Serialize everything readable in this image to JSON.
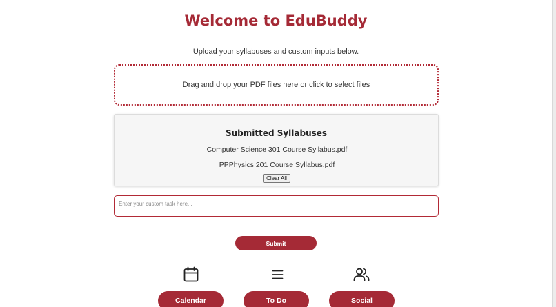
{
  "header": {
    "title": "Welcome to EduBuddy",
    "subtitle": "Upload your syllabuses and custom inputs below."
  },
  "dropzone": {
    "text": "Drag and drop your PDF files here or click to select files"
  },
  "syllabi": {
    "title": "Submitted Syllabuses",
    "files": [
      "Computer Science 301 Course Syllabus.pdf",
      "PPPhysics 201 Course Syllabus.pdf"
    ],
    "clear_label": "Clear All"
  },
  "task": {
    "placeholder": "Enter your custom task here..."
  },
  "submit_label": "Submit",
  "nav": {
    "calendar": {
      "label": "Calendar",
      "icon": "calendar-icon"
    },
    "todo": {
      "label": "To Do",
      "icon": "list-icon"
    },
    "social": {
      "label": "Social",
      "icon": "users-icon"
    }
  },
  "colors": {
    "accent": "#a52a36"
  }
}
